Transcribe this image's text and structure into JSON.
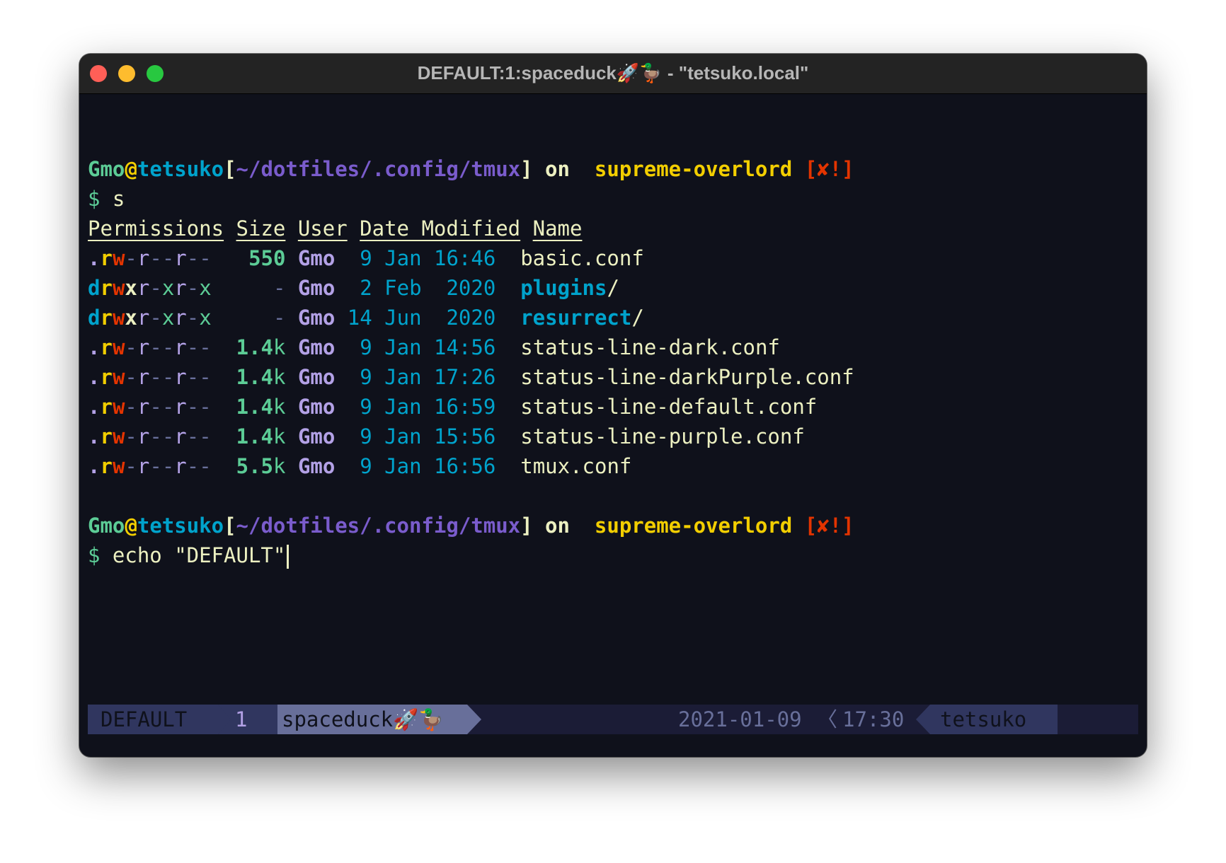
{
  "window": {
    "title": "DEFAULT:1:spaceduck🚀🦆 - \"tetsuko.local\""
  },
  "prompt": {
    "user": "Gmo",
    "at": "@",
    "host": "tetsuko",
    "path": "~/dotfiles/.config/tmux",
    "on": "on",
    "branch_icon": "",
    "branch": "supreme-overlord",
    "status": "[✘!]",
    "dollar": "$"
  },
  "commands": [
    "s",
    "echo \"DEFAULT\""
  ],
  "listing": {
    "headers": [
      "Permissions",
      "Size",
      "User",
      "Date Modified",
      "Name"
    ],
    "rows": [
      {
        "perm": ".rw-r--r--",
        "size": "550",
        "user": "Gmo",
        "date": "9 Jan 16:46",
        "name": "basic.conf",
        "is_dir": false
      },
      {
        "perm": "drwxr-xr-x",
        "size": "-",
        "user": "Gmo",
        "date": "2 Feb  2020",
        "name": "plugins",
        "is_dir": true
      },
      {
        "perm": "drwxr-xr-x",
        "size": "-",
        "user": "Gmo",
        "date": "14 Jun  2020",
        "name": "resurrect",
        "is_dir": true
      },
      {
        "perm": ".rw-r--r--",
        "size": "1.4k",
        "user": "Gmo",
        "date": "9 Jan 14:56",
        "name": "status-line-dark.conf",
        "is_dir": false
      },
      {
        "perm": ".rw-r--r--",
        "size": "1.4k",
        "user": "Gmo",
        "date": "9 Jan 17:26",
        "name": "status-line-darkPurple.conf",
        "is_dir": false
      },
      {
        "perm": ".rw-r--r--",
        "size": "1.4k",
        "user": "Gmo",
        "date": "9 Jan 16:59",
        "name": "status-line-default.conf",
        "is_dir": false
      },
      {
        "perm": ".rw-r--r--",
        "size": "1.4k",
        "user": "Gmo",
        "date": "9 Jan 15:56",
        "name": "status-line-purple.conf",
        "is_dir": false
      },
      {
        "perm": ".rw-r--r--",
        "size": "5.5k",
        "user": "Gmo",
        "date": "9 Jan 16:56",
        "name": "tmux.conf",
        "is_dir": false
      }
    ]
  },
  "statusbar": {
    "session": "DEFAULT",
    "window_index": "1",
    "window_name": "spaceduck🚀🦆",
    "date": "2021-01-09",
    "separator": "〈",
    "time": "17:30",
    "host": "tetsuko"
  },
  "colors": {
    "background": "#0f111b",
    "foreground": "#ecf0c1",
    "green": "#5ccc96",
    "cyan": "#00a3cc",
    "purple": "#7a5ccc",
    "lavender": "#b3a1e6",
    "yellow": "#f2ce00",
    "red": "#e33400",
    "grey": "#686f9a"
  }
}
